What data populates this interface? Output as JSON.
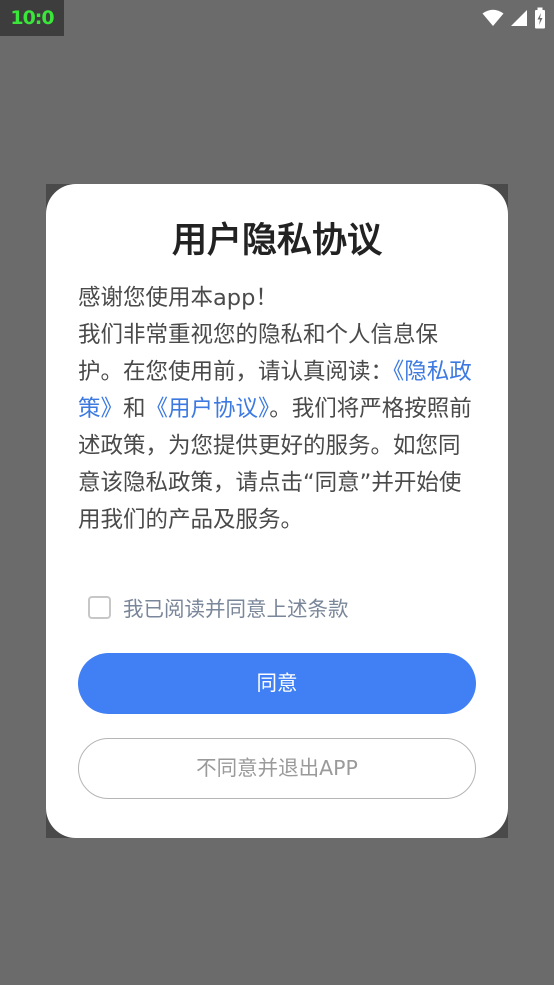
{
  "status_bar": {
    "time": "10:0"
  },
  "dialog": {
    "title": "用户隐私协议",
    "greeting": "感谢您使用本app！",
    "body_part1": "我们非常重视您的隐私和个人信息保护。在您使用前，请认真阅读：",
    "privacy_link": "《隐私政策》",
    "connector": "和",
    "user_agreement_link": "《用户协议》",
    "body_part2": "。我们将严格按照前述政策，为您提供更好的服务。如您同意该隐私政策，请点击“同意”并开始使用我们的产品及服务。",
    "checkbox_label": "我已阅读并同意上述条款",
    "checkbox_checked": false,
    "agree_label": "同意",
    "decline_label": "不同意并退出APP"
  },
  "colors": {
    "backdrop": "#6b6b6b",
    "primary": "#4080f4",
    "link": "#3d7ae0",
    "time_text": "#39e639"
  }
}
